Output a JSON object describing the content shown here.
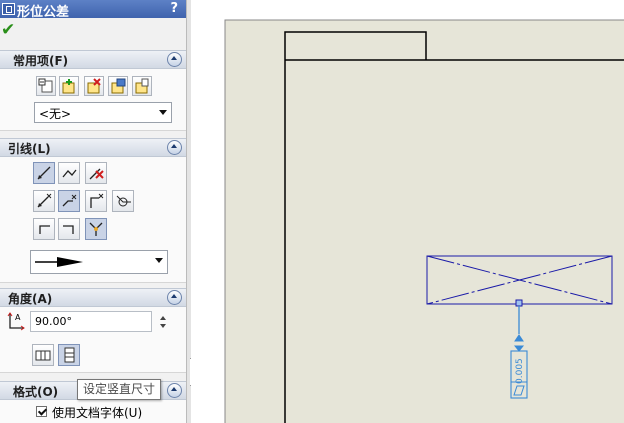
{
  "panel": {
    "title": "形位公差",
    "help": "?",
    "ok_icon": "checkmark-icon"
  },
  "groups": {
    "common": {
      "title": "常用项(F)",
      "style_select": "<无>"
    },
    "leader": {
      "title": "引线(L)"
    },
    "angle": {
      "title": "角度(A)",
      "value": "90.00°"
    },
    "format": {
      "title": "格式(O)",
      "use_doc_font": "使用文档字体(U)",
      "use_doc_font_checked": true
    }
  },
  "tooltip": "设定竖直尺寸",
  "drawing": {
    "tolerance_text": "0.005",
    "colors": {
      "sheet": "#e6e5d8",
      "annotation": "#1a1aa8",
      "selected": "#3a8ad6"
    }
  }
}
